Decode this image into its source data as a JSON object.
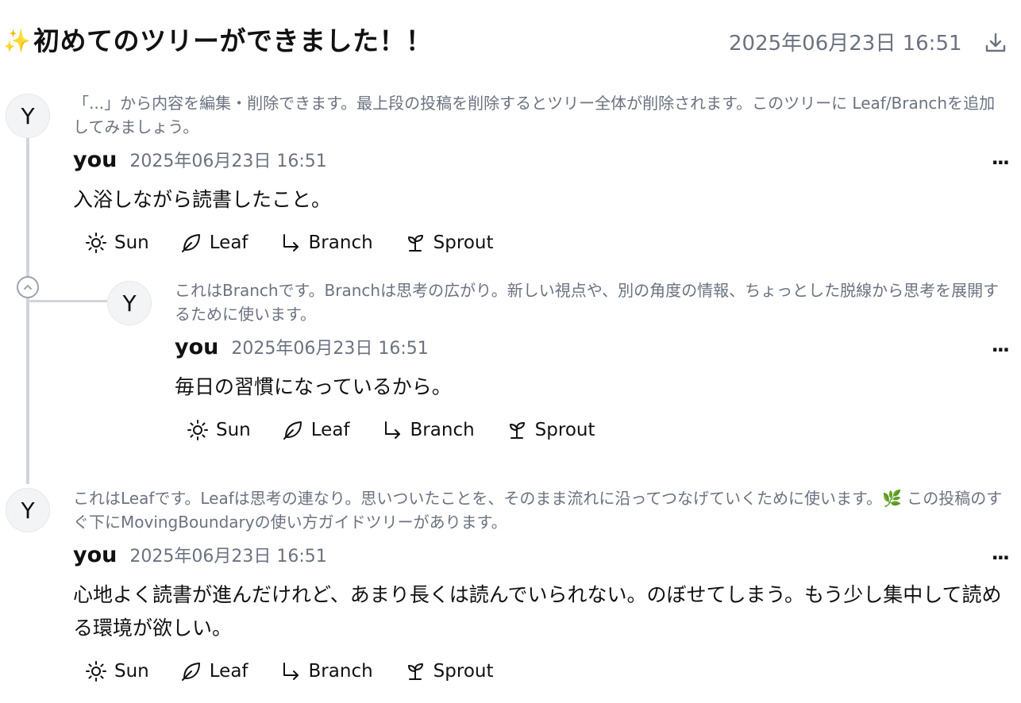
{
  "header": {
    "sparkle": "✨",
    "title": "初めてのツリーができました！！",
    "date": "2025年06月23日 16:51",
    "download_icon": "download-icon"
  },
  "posts": [
    {
      "avatar": "Y",
      "note": "「...」から内容を編集・削除できます。最上段の投稿を削除するとツリー全体が削除されます。このツリーに Leaf/Branchを追加してみましょう。",
      "author": "you",
      "date": "2025年06月23日 16:51",
      "more": "...",
      "body": "入浴しながら読書したこと。",
      "actions": [
        "Sun",
        "Leaf",
        "Branch",
        "Sprout"
      ]
    },
    {
      "avatar": "Y",
      "note": "これはBranchです。Branchは思考の広がり。新しい視点や、別の角度の情報、ちょっとした脱線から思考を展開するために使います。",
      "author": "you",
      "date": "2025年06月23日 16:51",
      "more": "...",
      "body": "毎日の習慣になっているから。",
      "actions": [
        "Sun",
        "Leaf",
        "Branch",
        "Sprout"
      ]
    },
    {
      "avatar": "Y",
      "note": "これはLeafです。Leafは思考の連なり。思いついたことを、そのまま流れに沿ってつなげていくために使います。🌿 この投稿のすぐ下にMovingBoundaryの使い方ガイドツリーがあります。",
      "author": "you",
      "date": "2025年06月23日 16:51",
      "more": "...",
      "body": "心地よく読書が進んだけれど、あまり長くは読んでいられない。のぼせてしまう。もう少し集中して読める環境が欲しい。",
      "actions": [
        "Sun",
        "Leaf",
        "Branch",
        "Sprout"
      ]
    }
  ],
  "icons": {
    "Sun": "sun-icon",
    "Leaf": "leaf-icon",
    "Branch": "branch-icon",
    "Sprout": "sprout-icon",
    "collapse": "chevron-up-icon"
  },
  "colors": {
    "muted_text": "#6b7280",
    "thread_line": "#d1d5db",
    "avatar_bg": "#f3f4f6",
    "sparkle": "#f5b301"
  }
}
